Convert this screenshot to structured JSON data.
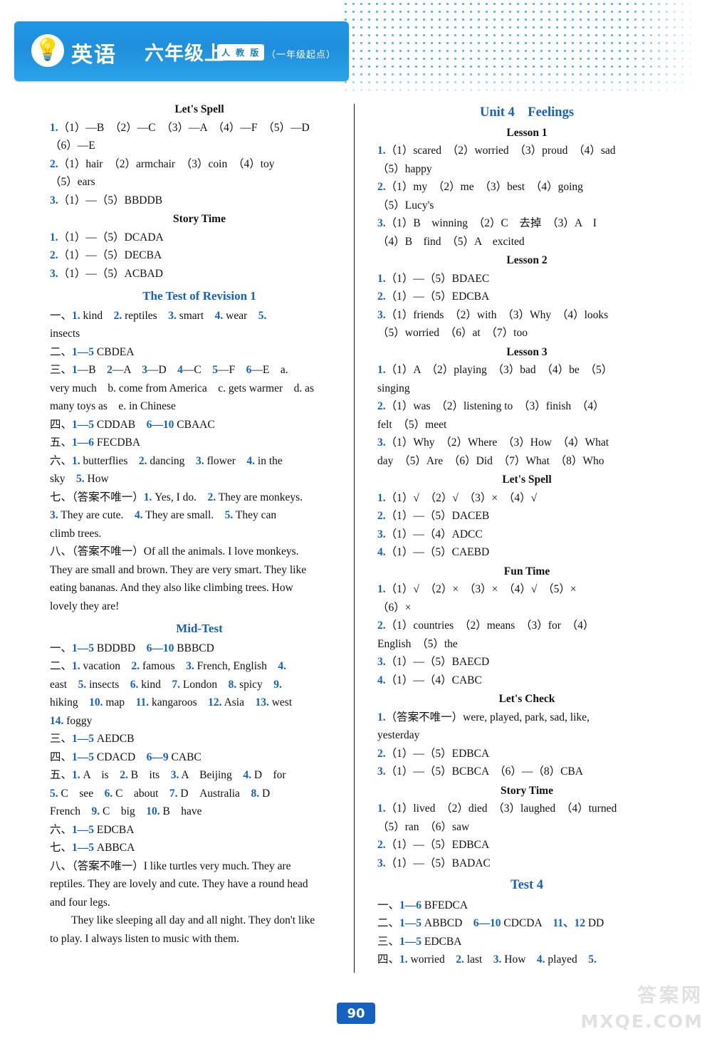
{
  "banner": {
    "title_main": "英语",
    "title_grade": "六年级上",
    "publisher_badge": "人 教 版",
    "publisher_note": "（一年级起点）",
    "bulb_icon": "lightbulb-icon"
  },
  "page_number": "90",
  "watermark": {
    "cn": "答案网",
    "en": "MXQE.COM"
  },
  "left_column": [
    {
      "type": "header",
      "text": "Let's Spell"
    },
    {
      "type": "line",
      "html": "<span class='n'>1.</span>（1）—B　（2）—C　（3）—A　（4）—F　（5）—D"
    },
    {
      "type": "line",
      "html": "（6）—E"
    },
    {
      "type": "line",
      "html": "<span class='n'>2.</span>（1）hair　（2）armchair　（3）coin　（4）toy"
    },
    {
      "type": "line",
      "html": "（5）ears"
    },
    {
      "type": "line",
      "html": "<span class='n'>3.</span>（1）—（5）BBDDB"
    },
    {
      "type": "header",
      "text": "Story Time"
    },
    {
      "type": "line",
      "html": "<span class='n'>1.</span>（1）—（5）DCADA"
    },
    {
      "type": "line",
      "html": "<span class='n'>2.</span>（1）—（5）DECBA"
    },
    {
      "type": "line",
      "html": "<span class='n'>3.</span>（1）—（5）ACBAD"
    },
    {
      "type": "header-blue",
      "text": "The Test of Revision 1"
    },
    {
      "type": "line",
      "html": "一、<span class='n'>1.</span> kind　<span class='n'>2.</span> reptiles　<span class='n'>3.</span> smart　<span class='n'>4.</span> wear　<span class='n'>5.</span>"
    },
    {
      "type": "line",
      "html": "insects"
    },
    {
      "type": "line",
      "html": "二、<span class='n'>1—5</span> CBDEA"
    },
    {
      "type": "line",
      "html": "三、<span class='n'>1</span>—B　<span class='n'>2</span>—A　<span class='n'>3</span>—D　<span class='n'>4</span>—C　<span class='n'>5</span>—F　<span class='n'>6</span>—E　a."
    },
    {
      "type": "line",
      "html": "very much　b. come from America　c. gets warmer　d. as"
    },
    {
      "type": "line",
      "html": "many toys as　e. in Chinese"
    },
    {
      "type": "line",
      "html": "四、<span class='n'>1—5</span> CDDAB　<span class='n'>6—10</span> CBAAC"
    },
    {
      "type": "line",
      "html": "五、<span class='n'>1—6</span> FECDBA"
    },
    {
      "type": "line",
      "html": "六、<span class='n'>1.</span> butterflies　<span class='n'>2.</span> dancing　<span class='n'>3.</span> flower　<span class='n'>4.</span> in the"
    },
    {
      "type": "line",
      "html": "sky　<span class='n'>5.</span> How"
    },
    {
      "type": "line",
      "html": "七、（答案不唯一）<span class='n'>1.</span> Yes, I do.　<span class='n'>2.</span> They are monkeys."
    },
    {
      "type": "line",
      "html": "<span class='n'>3.</span> They are cute.　<span class='n'>4.</span> They are small.　<span class='n'>5.</span> They can"
    },
    {
      "type": "line",
      "html": "climb trees."
    },
    {
      "type": "line",
      "html": "八、（答案不唯一）Of all the animals. I love monkeys."
    },
    {
      "type": "line",
      "html": "They are small and brown. They are very smart. They like"
    },
    {
      "type": "line",
      "html": "eating bananas. And they also like climbing trees. How"
    },
    {
      "type": "line",
      "html": "lovely they are!"
    },
    {
      "type": "header-blue",
      "text": "Mid-Test"
    },
    {
      "type": "line",
      "html": "一、<span class='n'>1—5</span> BDDBD　<span class='n'>6—10</span> BBBCD"
    },
    {
      "type": "line",
      "html": "二、<span class='n'>1.</span> vacation　<span class='n'>2.</span> famous　<span class='n'>3.</span> French, English　<span class='n'>4.</span>"
    },
    {
      "type": "line",
      "html": "east　<span class='n'>5.</span> insects　<span class='n'>6.</span> kind　<span class='n'>7.</span> London　<span class='n'>8.</span> spicy　<span class='n'>9.</span>"
    },
    {
      "type": "line",
      "html": "hiking　<span class='n'>10.</span> map　<span class='n'>11.</span> kangaroos　<span class='n'>12.</span> Asia　<span class='n'>13.</span> west"
    },
    {
      "type": "line",
      "html": "<span class='n'>14.</span> foggy"
    },
    {
      "type": "line",
      "html": "三、<span class='n'>1—5</span> AEDCB"
    },
    {
      "type": "line",
      "html": "四、<span class='n'>1—5</span> CDACD　<span class='n'>6—9</span> CABC"
    },
    {
      "type": "line",
      "html": "五、<span class='n'>1.</span> A　is　<span class='n'>2.</span> B　its　<span class='n'>3.</span> A　Beijing　<span class='n'>4.</span> D　for"
    },
    {
      "type": "line",
      "html": "<span class='n'>5.</span> C　see　<span class='n'>6.</span> C　about　<span class='n'>7.</span> D　Australia　<span class='n'>8.</span> D"
    },
    {
      "type": "line",
      "html": "French　<span class='n'>9.</span> C　big　<span class='n'>10.</span> B　have"
    },
    {
      "type": "line",
      "html": "六、<span class='n'>1—5</span> EDCBA"
    },
    {
      "type": "line",
      "html": "七、<span class='n'>1—5</span> ABBCA"
    },
    {
      "type": "line",
      "html": "八、（答案不唯一）I like turtles very much. They are"
    },
    {
      "type": "line",
      "html": "reptiles. They are lovely and cute. They have a round head"
    },
    {
      "type": "line",
      "html": "and four legs."
    },
    {
      "type": "line-indent",
      "html": "They like sleeping all day and all night. They don't like"
    },
    {
      "type": "line",
      "html": "to play. I always listen to music with them."
    }
  ],
  "right_column": [
    {
      "type": "header-blue-big",
      "text": "Unit 4　Feelings"
    },
    {
      "type": "header",
      "text": "Lesson 1"
    },
    {
      "type": "line",
      "html": "<span class='n'>1.</span>（1）scared　（2）worried　（3）proud　（4）sad"
    },
    {
      "type": "line",
      "html": "（5）happy"
    },
    {
      "type": "line",
      "html": "<span class='n'>2.</span>（1）my　（2）me　（3）best　（4）going"
    },
    {
      "type": "line",
      "html": "（5）Lucy's"
    },
    {
      "type": "line",
      "html": "<span class='n'>3.</span>（1）B　winning　（2）C　去掉　（3）A　I"
    },
    {
      "type": "line",
      "html": "（4）B　find　（5）A　excited"
    },
    {
      "type": "header",
      "text": "Lesson 2"
    },
    {
      "type": "line",
      "html": "<span class='n'>1.</span>（1）—（5）BDAEC"
    },
    {
      "type": "line",
      "html": "<span class='n'>2.</span>（1）—（5）EDCBA"
    },
    {
      "type": "line",
      "html": "<span class='n'>3.</span>（1）friends　（2）with　（3）Why　（4）looks"
    },
    {
      "type": "line",
      "html": "（5）worried　（6）at　（7）too"
    },
    {
      "type": "header",
      "text": "Lesson 3"
    },
    {
      "type": "line",
      "html": "<span class='n'>1.</span>（1）A　（2）playing　（3）bad　（4）be　（5）"
    },
    {
      "type": "line",
      "html": "singing"
    },
    {
      "type": "line",
      "html": "<span class='n'>2.</span>（1）was　（2）listening to　（3）finish　（4）"
    },
    {
      "type": "line",
      "html": "felt　（5）meet"
    },
    {
      "type": "line",
      "html": "<span class='n'>3.</span>（1）Why　（2）Where　（3）How　（4）What"
    },
    {
      "type": "line",
      "html": "day　（5）Are　（6）Did　（7）What　（8）Who"
    },
    {
      "type": "header",
      "text": "Let's Spell"
    },
    {
      "type": "line",
      "html": "<span class='n'>1.</span>（1）√　（2）√　（3）×　（4）√"
    },
    {
      "type": "line",
      "html": "<span class='n'>2.</span>（1）—（5）DACEB"
    },
    {
      "type": "line",
      "html": "<span class='n'>3.</span>（1）—（4）ADCC"
    },
    {
      "type": "line",
      "html": "<span class='n'>4.</span>（1）—（5）CAEBD"
    },
    {
      "type": "header",
      "text": "Fun Time"
    },
    {
      "type": "line",
      "html": "<span class='n'>1.</span>（1）√　（2）×　（3）×　（4）√　（5）×"
    },
    {
      "type": "line",
      "html": "（6）×"
    },
    {
      "type": "line",
      "html": "<span class='n'>2.</span>（1）countries　（2）means　（3）for　（4）"
    },
    {
      "type": "line",
      "html": "English　（5）the"
    },
    {
      "type": "line",
      "html": "<span class='n'>3.</span>（1）—（5）BAECD"
    },
    {
      "type": "line",
      "html": "<span class='n'>4.</span>（1）—（4）CABC"
    },
    {
      "type": "header",
      "text": "Let's Check"
    },
    {
      "type": "line",
      "html": "<span class='n'>1.</span>（答案不唯一）were, played, park, sad, like,"
    },
    {
      "type": "line",
      "html": "yesterday"
    },
    {
      "type": "line",
      "html": "<span class='n'>2.</span>（1）—（5）EDBCA"
    },
    {
      "type": "line",
      "html": "<span class='n'>3.</span>（1）—（5）BCBCA　（6）—（8）CBA"
    },
    {
      "type": "header",
      "text": "Story Time"
    },
    {
      "type": "line",
      "html": "<span class='n'>1.</span>（1）lived　（2）died　（3）laughed　（4）turned"
    },
    {
      "type": "line",
      "html": "（5）ran　（6）saw"
    },
    {
      "type": "line",
      "html": "<span class='n'>2.</span>（1）—（5）EDBCA"
    },
    {
      "type": "line",
      "html": "<span class='n'>3.</span>（1）—（5）BADAC"
    },
    {
      "type": "header-blue-big",
      "text": "Test 4"
    },
    {
      "type": "line",
      "html": "一、<span class='n'>1—6</span> BFEDCA"
    },
    {
      "type": "line",
      "html": "二、<span class='n'>1—5</span> ABBCD　<span class='n'>6—10</span> CDCDA　<span class='n'>11、12</span> DD"
    },
    {
      "type": "line",
      "html": "三、<span class='n'>1—5</span> EDCBA"
    },
    {
      "type": "line",
      "html": "四、<span class='n'>1.</span> worried　<span class='n'>2.</span> last　<span class='n'>3.</span> How　<span class='n'>4.</span> played　<span class='n'>5.</span>"
    }
  ]
}
